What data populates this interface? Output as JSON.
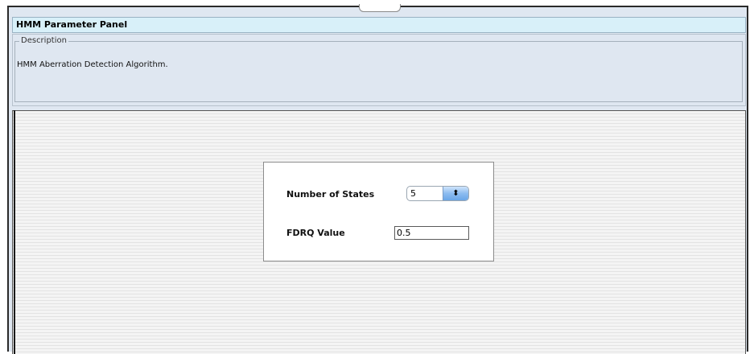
{
  "panel": {
    "title": "HMM Parameter Panel"
  },
  "description": {
    "legend": "Description",
    "text": "HMM Aberration Detection Algorithm."
  },
  "params": {
    "states_label": "Number of States",
    "states_value": "5",
    "states_spinner_glyph": "⬍",
    "fdrq_label": "FDRQ Value",
    "fdrq_value": "0.5"
  },
  "colors": {
    "header_bg": "#d8f0f9",
    "panel_bg": "#dfe7f1",
    "spinner_accent": "#6aa6e8"
  }
}
